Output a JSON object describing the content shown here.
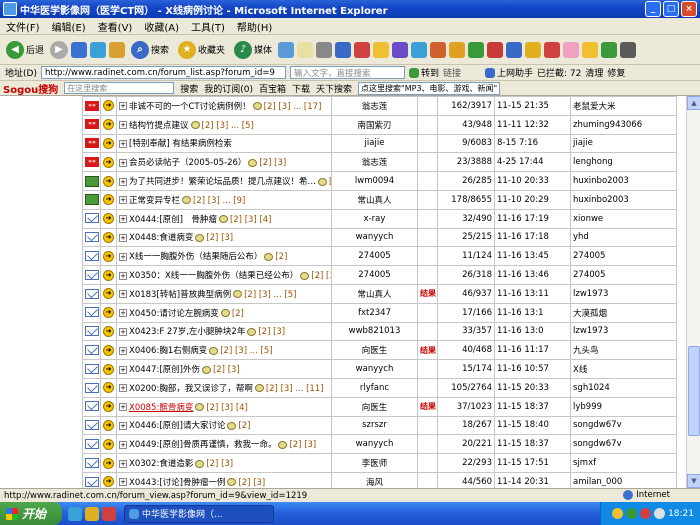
{
  "window": {
    "title": "中华医学影像网（医学CT网） - X线病例讨论 - Microsoft Internet Explorer"
  },
  "menu": [
    "文件(F)",
    "编辑(E)",
    "查看(V)",
    "收藏(A)",
    "工具(T)",
    "帮助(H)"
  ],
  "toolbar": {
    "back": "后退",
    "search": "搜索",
    "favorites": "收藏夹",
    "media": "媒体"
  },
  "address": {
    "label": "地址(D)",
    "url": "http://www.radinet.com.cn/forum_list.asp?forum_id=9",
    "hint": "输入文字，直接搜索",
    "goto": "转到",
    "links": "链接",
    "shanghai": "上网助手",
    "blocked": "已拦截: 72",
    "clean": "清理",
    "repair": "修复"
  },
  "sogou": {
    "logo": "Sogou搜狗",
    "search_hint": "在这里搜索",
    "search_btn": "搜索",
    "subscribe": "我的订阅(0)",
    "baibao": "百宝箱",
    "download": "下载",
    "tianxia": "天下搜索",
    "dropdown": "点这里搜索\"MP3、电影、游戏、新闻\""
  },
  "posts": [
    {
      "icon": "hot",
      "title": "非诚不可的一个CT讨论病例例！",
      "pages": "[2] [3] ... [17]",
      "author": "翁志莲",
      "tag": "",
      "count": "162/3917",
      "time": "11-15 21:35",
      "last": "老鼠爱大米"
    },
    {
      "icon": "hot",
      "title": "结构竹提点建议",
      "pages": "[2] [3] ... [5]",
      "author": "南国紫刃",
      "tag": "",
      "count": "43/948",
      "time": "11-11 12:32",
      "last": "zhuming943066"
    },
    {
      "icon": "hot",
      "title": "[特别奉献] 有结果病例检索",
      "pages": "",
      "author": "jiajie",
      "tag": "",
      "count": "9/6083",
      "time": "8-15 7:16",
      "last": "jiajie"
    },
    {
      "icon": "hot",
      "title": "会员必读帖子（2005-05-26）",
      "pages": "[2] [3]",
      "author": "翁志莲",
      "tag": "",
      "count": "23/3888",
      "time": "4-25 17:44",
      "last": "lenghong"
    },
    {
      "icon": "lock",
      "title": "为了共同进步！繁荣论坛品质！提几点建议！希…",
      "pages": "[2] [3]",
      "author": "lwm0094",
      "tag": "",
      "count": "26/285",
      "time": "11-10 20:33",
      "last": "huxinbo2003"
    },
    {
      "icon": "lock",
      "title": "正常变异专栏",
      "pages": "[2] [3] ... [9]",
      "author": "常山真人",
      "tag": "",
      "count": "178/8655",
      "time": "11-10 20:29",
      "last": "huxinbo2003"
    },
    {
      "icon": "env",
      "title": "X0444:[原创]　骨肿瘤",
      "pages": "[2] [3] [4]",
      "author": "x-ray",
      "tag": "",
      "count": "32/490",
      "time": "11-16 17:19",
      "last": "xionwe"
    },
    {
      "icon": "env",
      "title": "X0448:食道病变",
      "pages": "[2] [3]",
      "author": "wanyych",
      "tag": "",
      "count": "25/215",
      "time": "11-16 17:18",
      "last": "yhd"
    },
    {
      "icon": "env",
      "title": "X线一一胸腹外伤（结果随后公布）",
      "pages": "[2]",
      "author": "274005",
      "tag": "",
      "count": "11/124",
      "time": "11-16 13:45",
      "last": "274005"
    },
    {
      "icon": "env",
      "title": "X0350：X线一一胸腹外伤（结果已经公布）",
      "pages": "[2] [3]",
      "author": "274005",
      "tag": "",
      "count": "26/318",
      "time": "11-16 13:46",
      "last": "274005"
    },
    {
      "icon": "env",
      "title": "X0183[转帖]普放典型病例",
      "pages": "[2] [3] ... [5]",
      "author": "常山真人",
      "tag": "结果",
      "count": "46/937",
      "time": "11-16 13:11",
      "last": "lzw1973"
    },
    {
      "icon": "env",
      "title": "X0450:请讨论左腕病变",
      "pages": "[2]",
      "author": "fxt2347",
      "tag": "",
      "count": "17/166",
      "time": "11-16 13:1",
      "last": "大漠孤烟"
    },
    {
      "icon": "env",
      "title": "X0423:F 27岁,左小腿肿块2年",
      "pages": "[2] [3]",
      "author": "wwb821013",
      "tag": "",
      "count": "33/357",
      "time": "11-16 13:0",
      "last": "lzw1973"
    },
    {
      "icon": "env",
      "title": "X0406:胸1右侧病变",
      "pages": "[2] [3] ... [5]",
      "author": "向医生",
      "tag": "结果",
      "count": "40/468",
      "time": "11-16 11:17",
      "last": "九头鸟"
    },
    {
      "icon": "env",
      "title": "X0447:[原创]外伤",
      "pages": "[2] [3]",
      "author": "wanyych",
      "tag": "",
      "count": "15/174",
      "time": "11-16 10:57",
      "last": "X线"
    },
    {
      "icon": "env",
      "title": "X0200:胸部，我又误诊了，帮啊",
      "pages": "[2] [3] ... [11]",
      "author": "rlyfanc",
      "tag": "",
      "count": "105/2764",
      "time": "11-15 20:33",
      "last": "sgh1024"
    },
    {
      "icon": "env",
      "title": "X0085:髌骨病变",
      "pages": "[2] [3] [4]",
      "author": "向医生",
      "tag": "结果",
      "count": "37/1023",
      "time": "11-15 18:37",
      "last": "lyb999",
      "link": true
    },
    {
      "icon": "env",
      "title": "X0446:[原创]请大家讨论",
      "pages": "[2]",
      "author": "szrszr",
      "tag": "",
      "count": "18/267",
      "time": "11-15 18:40",
      "last": "songdw67v"
    },
    {
      "icon": "env",
      "title": "X0449:[原创]骨质再谨慎，救我一命。",
      "pages": "[2] [3]",
      "author": "wanyych",
      "tag": "",
      "count": "20/221",
      "time": "11-15 18:37",
      "last": "songdw67v"
    },
    {
      "icon": "env",
      "title": "X0302:食道造影",
      "pages": "[2] [3]",
      "author": "李医师",
      "tag": "",
      "count": "22/293",
      "time": "11-15 17:51",
      "last": "sjmxf"
    },
    {
      "icon": "env",
      "title": "X0443:[讨论]骨肿瘤一例",
      "pages": "[2] [3]",
      "author": "海风",
      "tag": "",
      "count": "44/560",
      "time": "11-14 20:31",
      "last": "amilan_000"
    },
    {
      "icon": "env",
      "title": "X0434:典型胸部病例一例",
      "pages": "[2] [3]",
      "author": "海风",
      "tag": "",
      "count": "17/181",
      "time": "11-14 19:42",
      "last": "黄恩辉"
    },
    {
      "icon": "env",
      "title": "X0253: .肱骨骨肿瘤，结果已公布，请畅谈。",
      "pages": "[2] [3]",
      "author": "ctm",
      "tag": "结果",
      "count": "47/1319",
      "time": "11-14 18:29",
      "last": "天天红"
    }
  ],
  "status": {
    "url": "http://www.radinet.com.cn/forum_view.asp?forum_id=9&view_id=1219",
    "zone": "Internet"
  },
  "taskbar": {
    "start": "开始",
    "task": "中华医学影像网（...",
    "clock": "18:21"
  },
  "colors": {
    "titlebar": "#1547c8",
    "taskbar": "#245edb",
    "start": "#3a8b36"
  }
}
